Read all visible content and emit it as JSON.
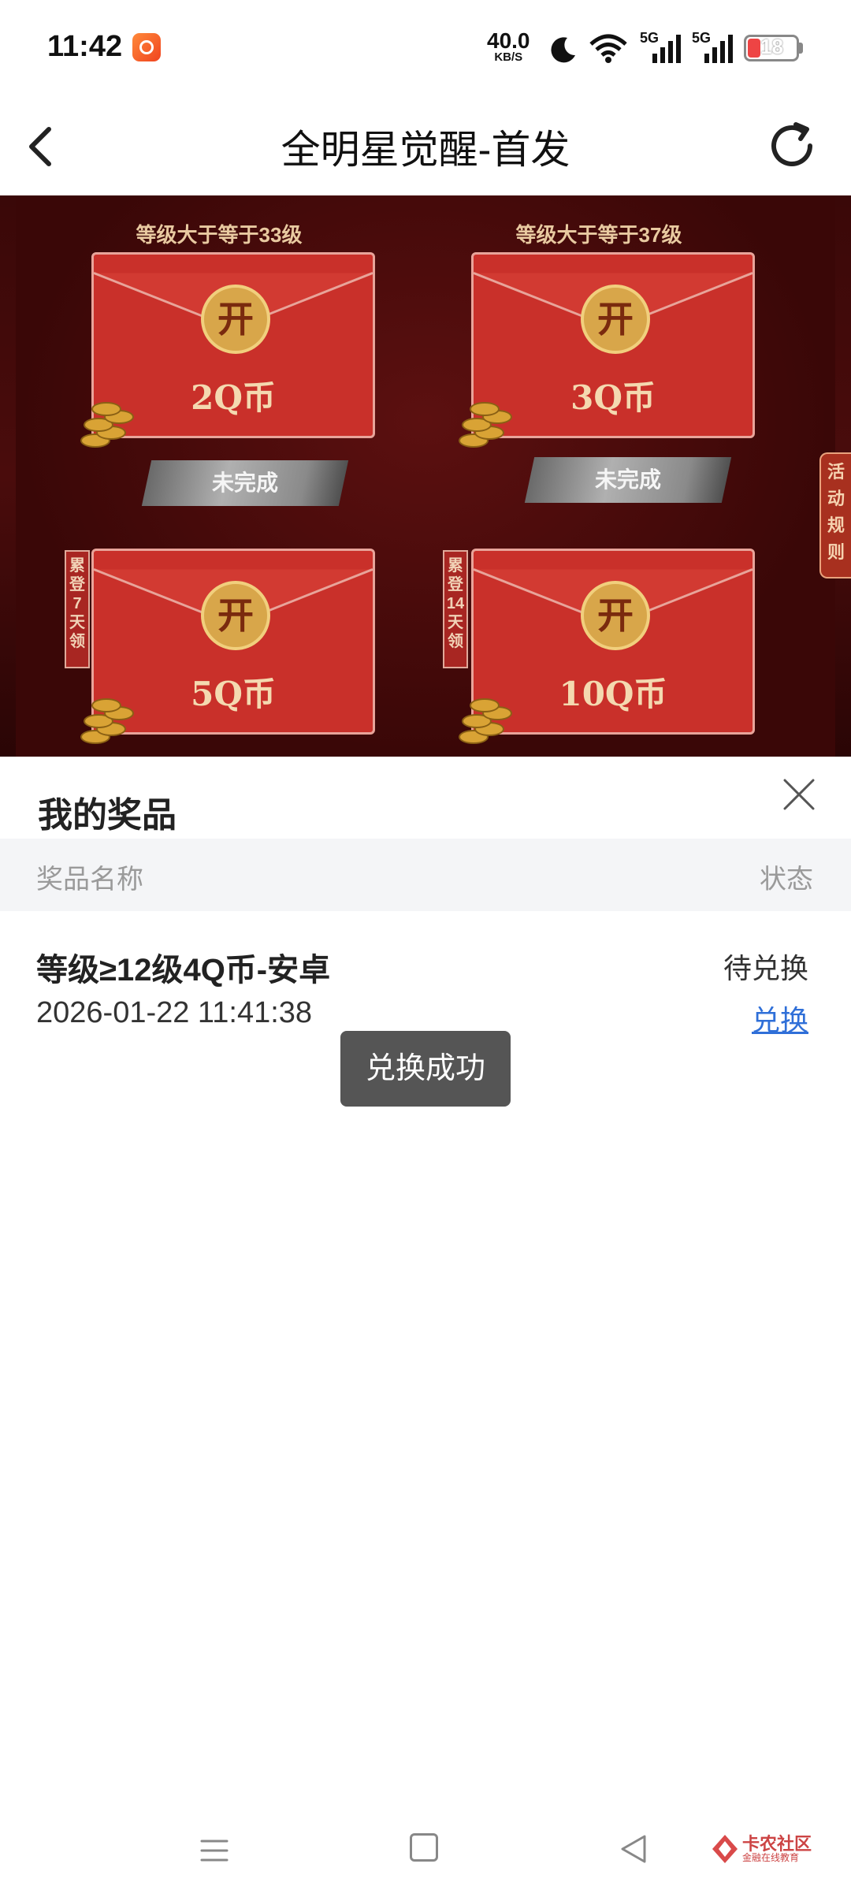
{
  "status_bar": {
    "time": "11:42",
    "net_speed": "40.0",
    "net_unit": "KB/S",
    "signal_1_label": "5G",
    "signal_2_label": "5G",
    "battery": "18"
  },
  "header": {
    "title": "全明星觉醒-首发"
  },
  "banner": {
    "rewards": [
      {
        "level_label": "等级大于等于33级",
        "open_label": "开",
        "amount": "2Q币",
        "badge": "未完成"
      },
      {
        "level_label": "等级大于等于37级",
        "open_label": "开",
        "amount": "3Q币",
        "badge": "未完成"
      },
      {
        "tag": "累登7天领",
        "open_label": "开",
        "amount": "5Q币"
      },
      {
        "tag": "累登14天领",
        "open_label": "开",
        "amount": "10Q币"
      }
    ],
    "rules_tab": "活动规则"
  },
  "prizes_panel": {
    "title": "我的奖品",
    "column_name": "奖品名称",
    "column_status": "状态",
    "items": [
      {
        "name": "等级≥12级4Q币-安卓",
        "time": "2026-01-22 11:41:38",
        "status": "待兑换",
        "action": "兑换"
      }
    ]
  },
  "toast": "兑换成功",
  "watermark": {
    "title": "卡农社区",
    "subtitle": "金融在线教育"
  },
  "colors": {
    "banner_bg": "#3a0808",
    "envelope": "#c9302a",
    "link": "#2f6fd8",
    "toast_bg": "#555555"
  }
}
